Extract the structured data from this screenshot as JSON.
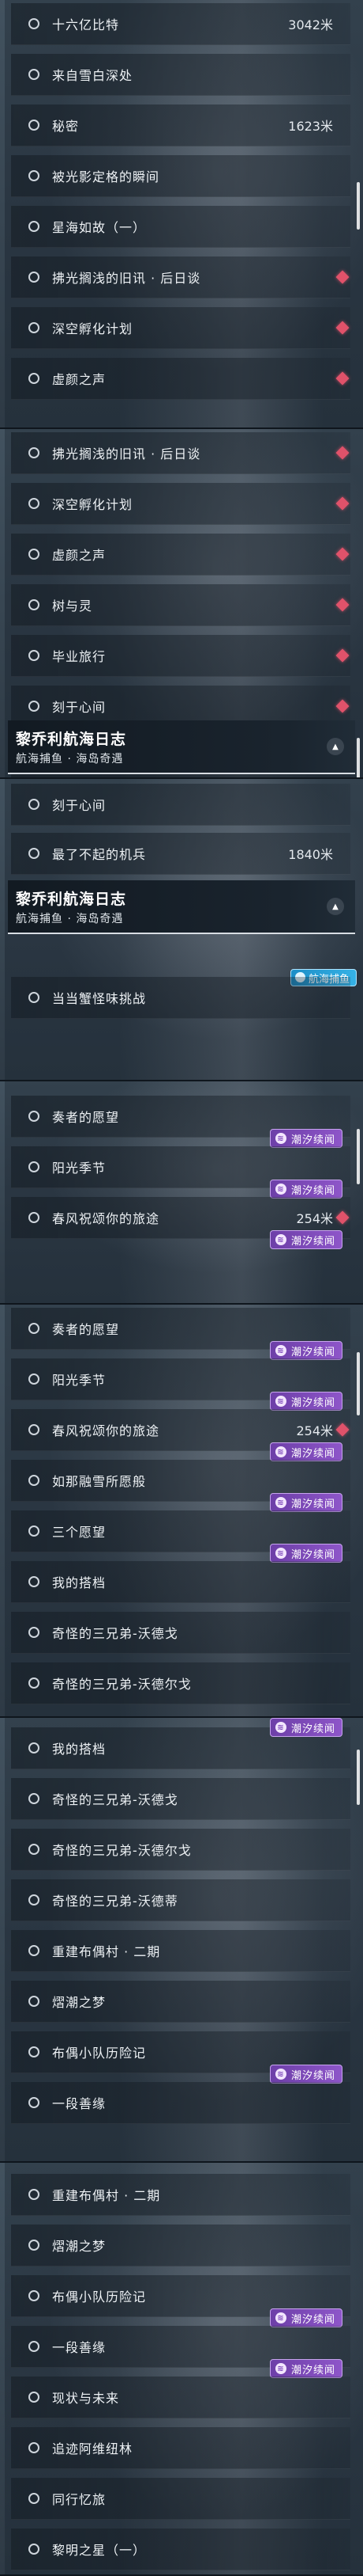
{
  "colors": {
    "event_badge": "#8e56c9",
    "fishing_tag": "#35b2e6",
    "marker_diamond": "#e0526a"
  },
  "shots": [
    {
      "rows": [
        {
          "label": "十六亿比特",
          "dist": "3042米"
        },
        {
          "label": "来自雪白深处"
        },
        {
          "label": "秘密",
          "dist": "1623米"
        },
        {
          "label": "被光影定格的瞬间"
        },
        {
          "label": "星海如故（一）"
        },
        {
          "label": "拂光搁浅的旧讯 · 后日谈",
          "marker": "red-diamond"
        },
        {
          "label": "深空孵化计划",
          "marker": "red-diamond"
        },
        {
          "label": "虚颜之声",
          "marker": "red-diamond"
        }
      ]
    },
    {
      "rows": [
        {
          "label": "拂光搁浅的旧讯 · 后日谈",
          "marker": "red-diamond"
        },
        {
          "label": "深空孵化计划",
          "marker": "red-diamond"
        },
        {
          "label": "虚颜之声",
          "marker": "red-diamond"
        },
        {
          "label": "树与灵",
          "marker": "red-diamond"
        },
        {
          "label": "毕业旅行",
          "marker": "red-diamond"
        },
        {
          "label": "刻于心间",
          "marker": "red-diamond"
        },
        {
          "label": "最了不起的机兵",
          "dist": "1840米"
        }
      ],
      "header": {
        "title": "黎乔利航海日志",
        "subtitle": "航海捕鱼 · 海岛奇遇"
      }
    },
    {
      "rows": [
        {
          "label": "刻于心间"
        },
        {
          "label": "最了不起的机兵",
          "dist": "1840米"
        }
      ],
      "header": {
        "title": "黎乔利航海日志",
        "subtitle": "航海捕鱼 · 海岛奇遇"
      },
      "tag": "航海捕鱼",
      "rows_after": [
        {
          "label": "当当蟹怪味挑战"
        }
      ]
    },
    {
      "rows": [
        {
          "label": "奏者的愿望",
          "badge_bottom": "潮汐续闻"
        },
        {
          "label": "阳光季节",
          "badge_bottom": "潮汐续闻"
        },
        {
          "label": "春风祝颂你的旅途",
          "dist": "254米",
          "badge_bottom": "潮汐续闻",
          "marker": "red-diamond"
        }
      ]
    },
    {
      "rows": [
        {
          "label": "奏者的愿望",
          "badge_bottom": "潮汐续闻"
        },
        {
          "label": "阳光季节",
          "badge_bottom": "潮汐续闻"
        },
        {
          "label": "春风祝颂你的旅途",
          "dist": "254米",
          "badge_bottom": "潮汐续闻",
          "marker": "red-diamond"
        },
        {
          "label": "如那融雪所愿般",
          "badge_bottom": "潮汐续闻"
        },
        {
          "label": "三个愿望",
          "badge_bottom": "潮汐续闻"
        },
        {
          "label": "我的搭档"
        },
        {
          "label": "奇怪的三兄弟-沃德戈"
        },
        {
          "label": "奇怪的三兄弟-沃德尔戈"
        }
      ]
    },
    {
      "rows": [
        {
          "label": "我的搭档",
          "badge_top": "潮汐续闻"
        },
        {
          "label": "奇怪的三兄弟-沃德戈"
        },
        {
          "label": "奇怪的三兄弟-沃德尔戈"
        },
        {
          "label": "奇怪的三兄弟-沃德蒂"
        },
        {
          "label": "重建布偶村 · 二期"
        },
        {
          "label": "熠潮之梦"
        },
        {
          "label": "布偶小队历险记",
          "badge_bottom": "潮汐续闻"
        },
        {
          "label": "一段善缘"
        }
      ]
    },
    {
      "rows": [
        {
          "label": "重建布偶村 · 二期"
        },
        {
          "label": "熠潮之梦"
        },
        {
          "label": "布偶小队历险记",
          "badge_bottom": "潮汐续闻"
        },
        {
          "label": "一段善缘",
          "badge_bottom": "潮汐续闻"
        },
        {
          "label": "现状与未来"
        },
        {
          "label": "追迹阿维纽林"
        },
        {
          "label": "同行忆旅"
        },
        {
          "label": "黎明之星（一）"
        }
      ]
    }
  ]
}
